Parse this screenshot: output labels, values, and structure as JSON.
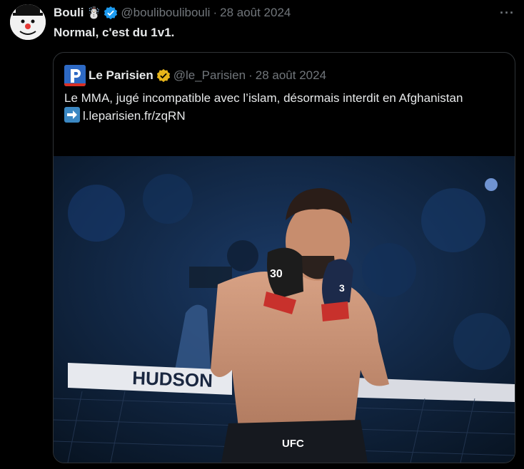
{
  "author": {
    "name": "Bouli",
    "emoji": "☃️",
    "handle": "@bouliboulibouli",
    "separator": "·",
    "date": "28 août 2024",
    "verified_color": "#1d9bf0"
  },
  "more_icon": "···",
  "tweet_text": "Normal, c'est du 1v1.",
  "quote": {
    "name": "Le Parisien",
    "handle": "@le_Parisien",
    "separator": "·",
    "date": "28 août 2024",
    "verified_color": "#f4c51d",
    "text": "Le MMA, jugé incompatible avec l’islam, désormais interdit en Afghanistan",
    "link": "l.leparisien.fr/zqRN",
    "media": {
      "banner_text": "HUDSON",
      "glove_number": "30",
      "shorts_text": "UFC"
    }
  }
}
